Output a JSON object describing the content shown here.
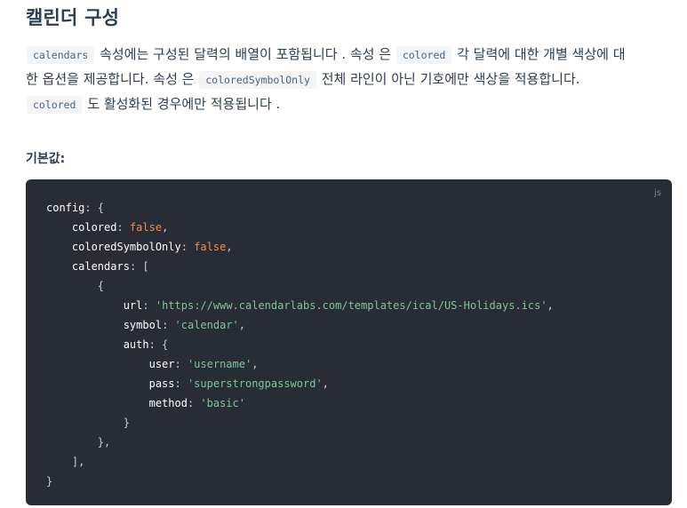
{
  "heading": "캘린더 구성",
  "paragraph": {
    "l1_code1": "calendars",
    "l1_text1": "속성에는 구성된 달력의 배열이 포함됩니다 . 속성 은",
    "l1_code2": "colored",
    "l1_text2": "각 달력에 대한 개별 색상에 대",
    "l2_text1": "한 옵션을 제공합니다. 속성 은",
    "l2_code1": "coloredSymbolOnly",
    "l2_text2": "전체 라인이 아닌 기호에만 색상을 적용합니다.",
    "l3_code1": "colored",
    "l3_text1": "도 활성화된 경우에만 적용됩니다 ."
  },
  "subheading": "기본값:",
  "codeblock": {
    "lang": "js",
    "config_key": "config",
    "colored_key": "colored",
    "colored_val": "false",
    "coloredSymbolOnly_key": "coloredSymbolOnly",
    "coloredSymbolOnly_val": "false",
    "calendars_key": "calendars",
    "url_key": "url",
    "url_val": "'https://www.calendarlabs.com/templates/ical/US-Holidays.ics'",
    "symbol_key": "symbol",
    "symbol_val": "'calendar'",
    "auth_key": "auth",
    "user_key": "user",
    "user_val": "'username'",
    "pass_key": "pass",
    "pass_val": "'superstrongpassword'",
    "method_key": "method",
    "method_val": "'basic'"
  },
  "colors": {
    "code_bg": "#282c34",
    "string": "#7ec699",
    "boolean": "#f08d49",
    "inline_code_bg": "#f3f4f5",
    "inline_code_text": "#476582",
    "text": "#2c3e50"
  }
}
